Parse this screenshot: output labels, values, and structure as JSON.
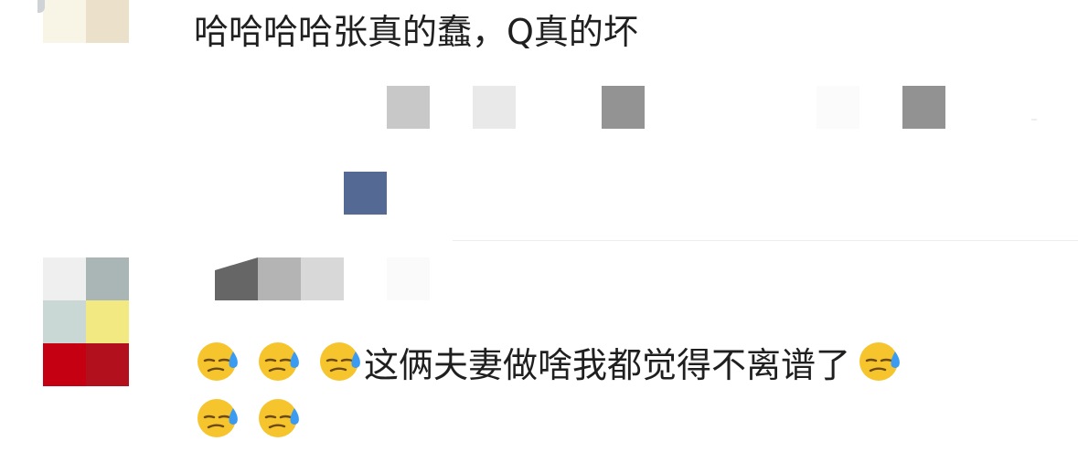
{
  "comments": [
    {
      "text": "哈哈哈哈张真的蠢，Q真的坏",
      "avatar_colors": [
        "#f8f5e6",
        "#ebe1cb"
      ]
    },
    {
      "text": "这俩夫妻做啥我都觉得不离谱了",
      "avatar_colors": [
        "#efefef",
        "#a9b6b5",
        "#c9d8d5",
        "#f2e982",
        "#c50012",
        "#b3101e"
      ],
      "emoji_icon": "downcast-face-with-sweat-icon"
    }
  ],
  "colors": {
    "text": "#1f1f1f",
    "divider": "#ececec",
    "link_blue": "#546a95"
  }
}
